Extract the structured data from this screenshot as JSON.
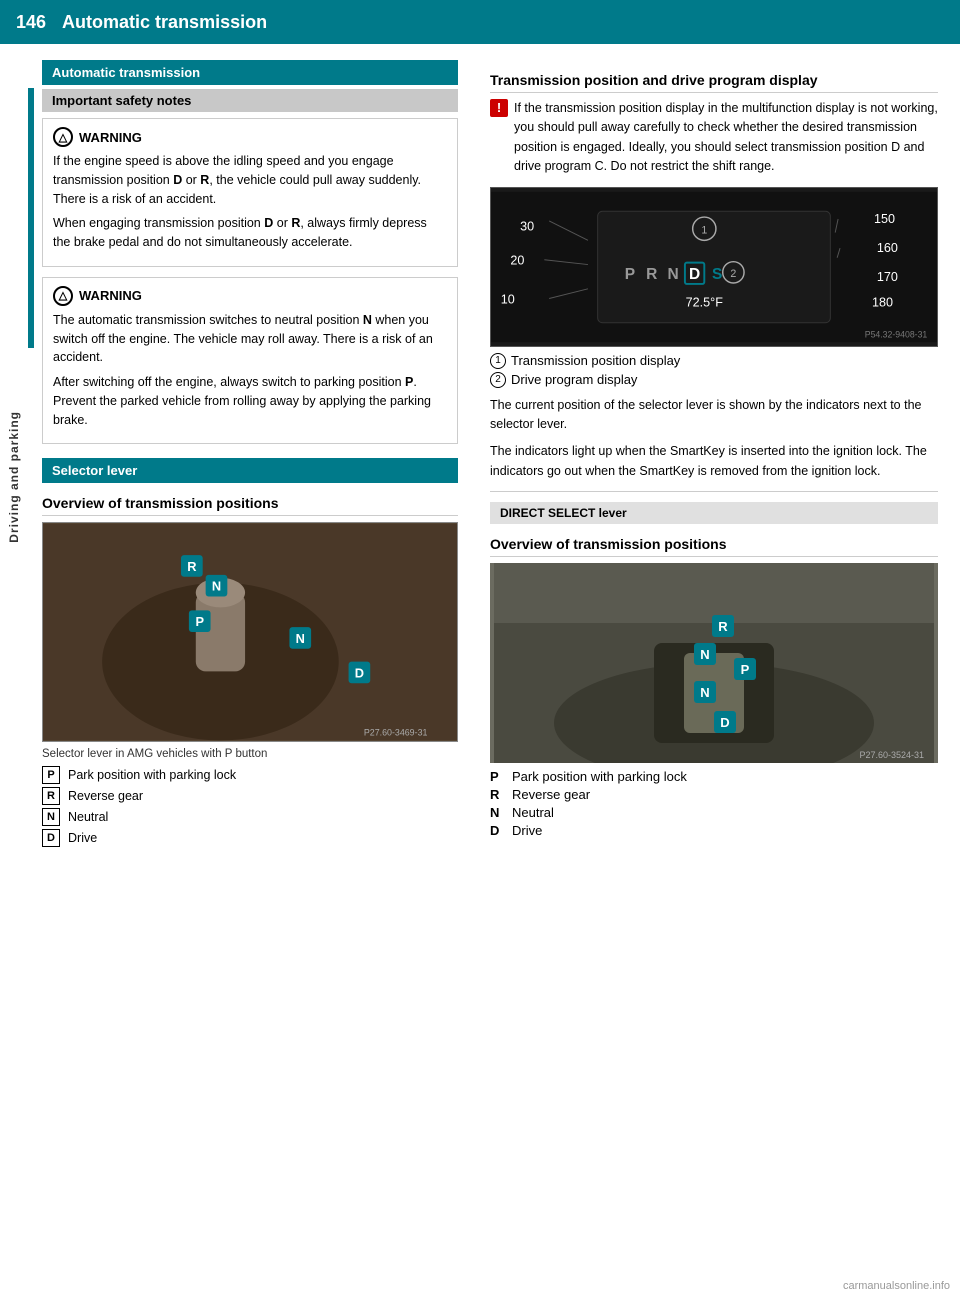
{
  "header": {
    "page_number": "146",
    "title": "Automatic transmission"
  },
  "sidebar": {
    "label": "Driving and parking"
  },
  "left_column": {
    "section_header": "Automatic transmission",
    "subsection_header": "Important safety notes",
    "warnings": [
      {
        "id": "warning1",
        "title": "WARNING",
        "paragraphs": [
          "If the engine speed is above the idling speed and you engage transmission position D or R, the vehicle could pull away suddenly. There is a risk of an accident.",
          "When engaging transmission position D or R, always firmly depress the brake pedal and do not simultaneously accelerate."
        ]
      },
      {
        "id": "warning2",
        "title": "WARNING",
        "paragraphs": [
          "The automatic transmission switches to neutral position N when you switch off the engine. The vehicle may roll away. There is a risk of an accident.",
          "After switching off the engine, always switch to parking position P. Prevent the parked vehicle from rolling away by applying the parking brake."
        ]
      }
    ],
    "selector_lever": {
      "header": "Selector lever",
      "overview_title": "Overview of transmission positions",
      "img_caption": "Selector lever in AMG vehicles with P button",
      "img_ref": "P27.60-3469-31",
      "legend": [
        {
          "badge": "P",
          "text": "Park position with parking lock"
        },
        {
          "badge": "R",
          "text": "Reverse gear"
        },
        {
          "badge": "N",
          "text": "Neutral"
        },
        {
          "badge": "D",
          "text": "Drive"
        }
      ]
    }
  },
  "right_column": {
    "transmission_display": {
      "title": "Transmission position and drive program display",
      "info_warning": "If the transmission position display in the multifunction display is not working, you should pull away carefully to check whether the desired transmission position is engaged. Ideally, you should select transmission position D and drive program C. Do not restrict the shift range.",
      "display_values": {
        "left_numbers": [
          "30",
          "20",
          "10"
        ],
        "right_numbers": [
          "150",
          "160",
          "170",
          "180"
        ],
        "prnd": "P R N D",
        "active": "D",
        "drive": "S",
        "circle_num": "2",
        "temperature": "72.5°F",
        "img_ref": "P54.32-9408-31"
      },
      "annotations": [
        {
          "num": "1",
          "text": "Transmission position display"
        },
        {
          "num": "2",
          "text": "Drive program display"
        }
      ],
      "body_text": [
        "The current position of the selector lever is shown by the indicators next to the selector lever.",
        "The indicators light up when the SmartKey is inserted into the ignition lock. The indicators go out when the SmartKey is removed from the ignition lock."
      ]
    },
    "direct_select": {
      "header": "DIRECT SELECT lever",
      "overview_title": "Overview of transmission positions",
      "img_ref": "P27.60-3524-31",
      "legend": [
        {
          "key": "P",
          "text": "Park position with parking lock"
        },
        {
          "key": "R",
          "text": "Reverse gear"
        },
        {
          "key": "N",
          "text": "Neutral"
        },
        {
          "key": "D",
          "text": "Drive"
        }
      ]
    }
  },
  "watermark": "carmanualsonline.info"
}
